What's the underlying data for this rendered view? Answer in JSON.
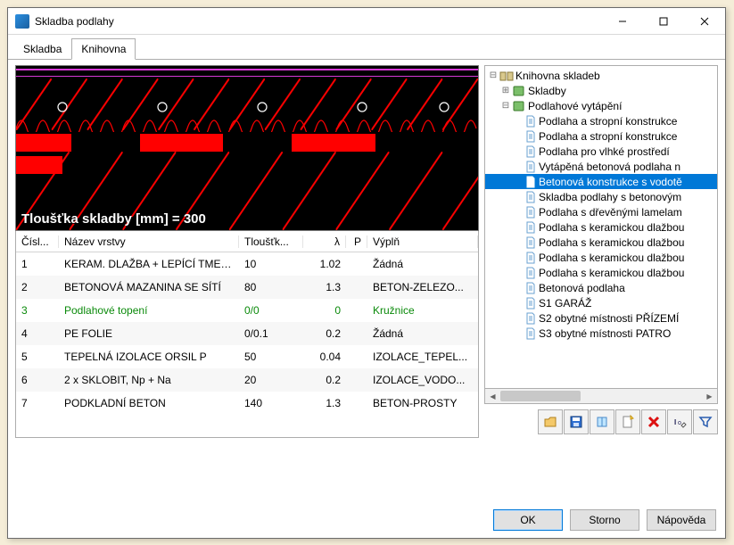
{
  "window": {
    "title": "Skladba podlahy"
  },
  "tabs": {
    "skladba": "Skladba",
    "knihovna": "Knihovna",
    "active": "knihovna"
  },
  "preview_label": "Tloušťka skladby [mm] = 300",
  "table": {
    "headers": {
      "num": "Čísl...",
      "name": "Název vrstvy",
      "thk": "Tloušťk...",
      "lam": "λ",
      "p": "P",
      "fill": "Výplň"
    },
    "rows": [
      {
        "num": "1",
        "name": "KERAM. DLAŽBA + LEPÍCÍ TMEL ...",
        "thk": "10",
        "lam": "1.02",
        "p": "",
        "fill": "Žádná"
      },
      {
        "num": "2",
        "name": "BETONOVÁ MAZANINA SE SÍTÍ",
        "thk": "80",
        "lam": "1.3",
        "p": "",
        "fill": "BETON-ZELEZO..."
      },
      {
        "num": "3",
        "name": "Podlahové topení",
        "thk": "0/0",
        "lam": "0",
        "p": "",
        "fill": "Kružnice",
        "green": true
      },
      {
        "num": "4",
        "name": "PE FOLIE",
        "thk": "0/0.1",
        "lam": "0.2",
        "p": "",
        "fill": "Žádná"
      },
      {
        "num": "5",
        "name": "TEPELNÁ IZOLACE ORSIL P",
        "thk": "50",
        "lam": "0.04",
        "p": "",
        "fill": "IZOLACE_TEPEL..."
      },
      {
        "num": "6",
        "name": "2 x SKLOBIT, Np + Na",
        "thk": "20",
        "lam": "0.2",
        "p": "",
        "fill": "IZOLACE_VODO..."
      },
      {
        "num": "7",
        "name": "PODKLADNÍ BETON",
        "thk": "140",
        "lam": "1.3",
        "p": "",
        "fill": "BETON-PROSTY"
      }
    ]
  },
  "tree": {
    "root": "Knihovna skladeb",
    "skladby": "Skladby",
    "vytapeni": "Podlahové vytápění",
    "items": [
      "Podlaha a stropní konstrukce",
      "Podlaha a stropní konstrukce",
      "Podlaha pro vlhké prostředí",
      "Vytápěná betonová podlaha n",
      "Betonová konstrukce s vodotě",
      "Skladba podlahy s betonovým",
      "Podlaha s dřevěnými lamelam",
      "Podlaha s keramickou dlažbou",
      "Podlaha s keramickou dlažbou",
      "Podlaha s keramickou dlažbou",
      "Podlaha s keramickou dlažbou",
      "Betonová podlaha",
      "S1 GARÁŽ",
      "S2 obytné místnosti PŘÍZEMÍ",
      "S3 obytné místnosti PATRO"
    ],
    "selected_index": 4
  },
  "toolbar": {
    "open": "open-icon",
    "save": "save-icon",
    "book": "book-icon",
    "new": "new-icon",
    "delete": "delete-icon",
    "rename": "rename-icon",
    "filter": "filter-icon"
  },
  "buttons": {
    "ok": "OK",
    "storno": "Storno",
    "napoveda": "Nápověda"
  }
}
